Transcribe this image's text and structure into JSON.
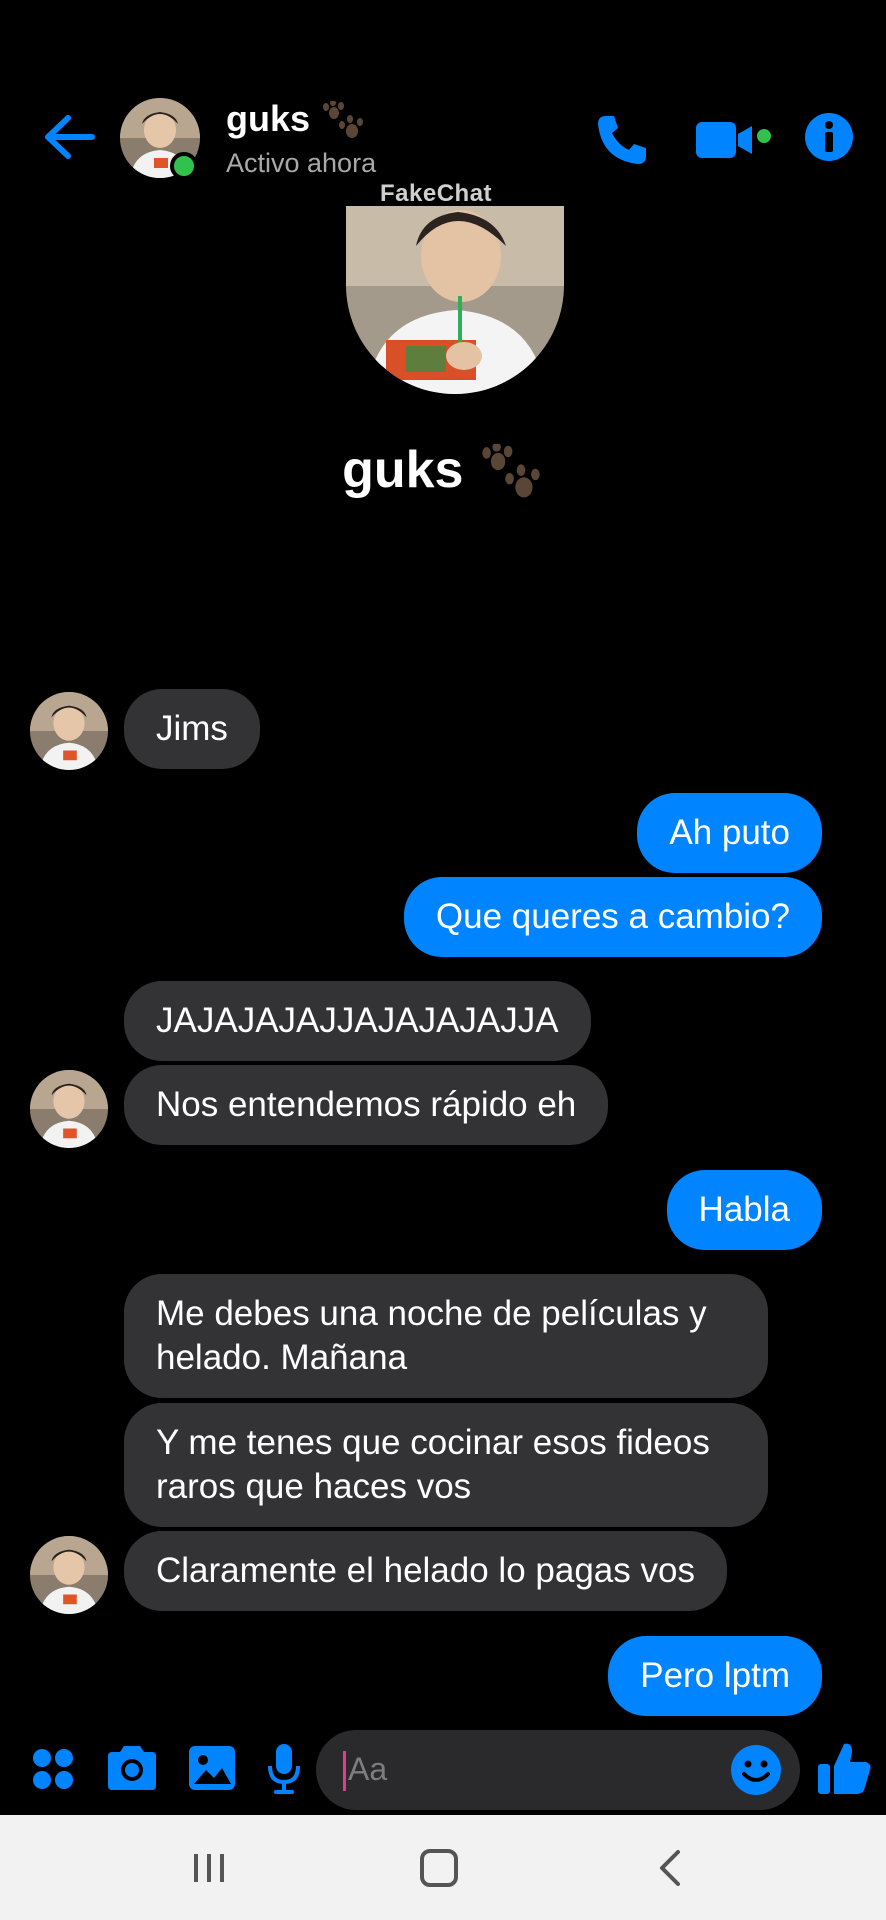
{
  "header": {
    "contact_name": "guks",
    "status": "Activo ahora",
    "back_icon": "arrow-left-icon",
    "actions": [
      "phone-icon",
      "video-camera-icon",
      "info-icon"
    ]
  },
  "watermark": "FakeChat",
  "profile": {
    "name": "guks"
  },
  "messages": [
    {
      "from": "them",
      "text": "Jims"
    },
    {
      "from": "me",
      "text": "Ah puto"
    },
    {
      "from": "me",
      "text": "Que queres a cambio?"
    },
    {
      "from": "them",
      "text": "JAJAJAJAJJAJAJAJAJJA"
    },
    {
      "from": "them",
      "text": "Nos entendemos rápido eh"
    },
    {
      "from": "me",
      "text": "Habla"
    },
    {
      "from": "them",
      "text": "Me debes una noche de películas y helado. Mañana"
    },
    {
      "from": "them",
      "text": "Y me tenes que cocinar esos fideos raros que haces vos"
    },
    {
      "from": "them",
      "text": "Claramente el helado lo pagas vos"
    },
    {
      "from": "me",
      "text": "Pero lptm"
    }
  ],
  "composer": {
    "placeholder": "Aa",
    "icons": [
      "apps-icon",
      "camera-icon",
      "gallery-icon",
      "microphone-icon",
      "emoji-icon",
      "thumbs-up-icon"
    ]
  },
  "colors": {
    "accent": "#0084ff",
    "incoming_bubble": "#333335",
    "background": "#000000",
    "online": "#31c24d"
  },
  "navbar": {
    "icons": [
      "recent-apps-icon",
      "home-icon",
      "back-icon"
    ]
  }
}
